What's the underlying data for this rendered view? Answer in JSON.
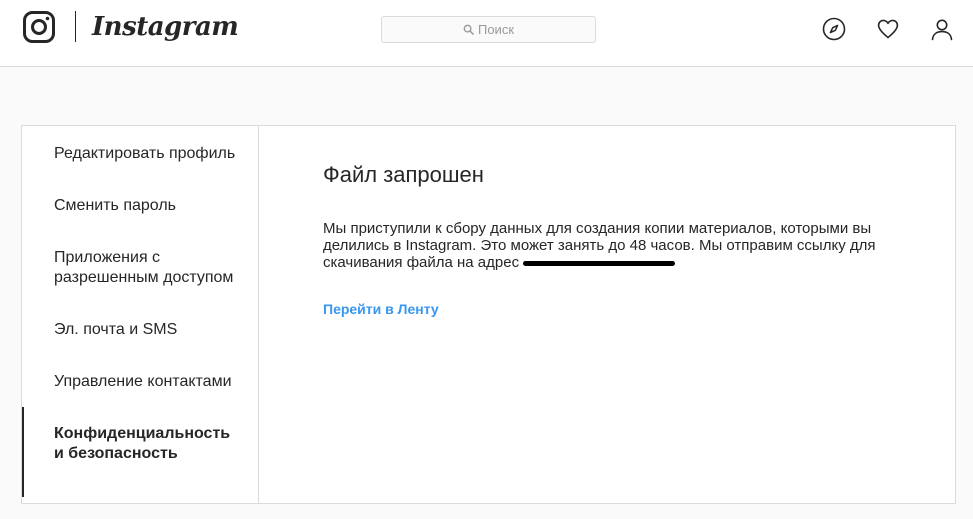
{
  "header": {
    "logo_text": "Instagram",
    "search_placeholder": "Поиск",
    "icons": [
      "instagram-glyph-icon",
      "explore-icon",
      "heart-icon",
      "profile-icon"
    ]
  },
  "sidebar": {
    "items": [
      {
        "label": "Редактировать профиль",
        "active": false
      },
      {
        "label": "Сменить пароль",
        "active": false
      },
      {
        "label": "Приложения с разрешенным доступом",
        "active": false
      },
      {
        "label": "Эл. почта и SMS",
        "active": false
      },
      {
        "label": "Управление контактами",
        "active": false
      },
      {
        "label": "Конфиденциальность и безопасность",
        "active": true
      }
    ]
  },
  "main": {
    "title": "Файл запрошен",
    "description": "Мы приступили к сбору данных для создания копии материалов, которыми вы делились в Instagram. Это может занять до 48 часов. Мы отправим ссылку для скачивания файла на адрес",
    "link_label": "Перейти в Ленту"
  },
  "colors": {
    "link": "#3897f0",
    "border": "#dbdbdb",
    "background": "#fafafa",
    "text": "#262626"
  }
}
